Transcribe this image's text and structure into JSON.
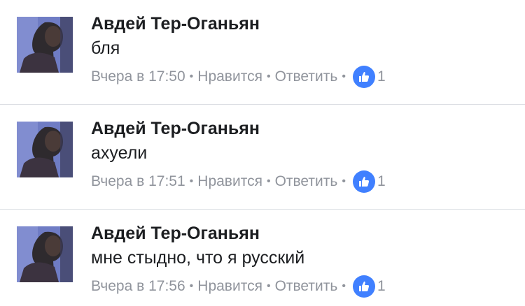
{
  "comments": [
    {
      "author": "Авдей Тер-Оганьян",
      "text": "бля",
      "time": "Вчера в 17:50",
      "like_label": "Нравится",
      "reply_label": "Ответить",
      "likes": "1"
    },
    {
      "author": "Авдей Тер-Оганьян",
      "text": "ахуели",
      "time": "Вчера в 17:51",
      "like_label": "Нравится",
      "reply_label": "Ответить",
      "likes": "1"
    },
    {
      "author": "Авдей Тер-Оганьян",
      "text": "мне стыдно, что я русский",
      "time": "Вчера в 17:56",
      "like_label": "Нравится",
      "reply_label": "Ответить",
      "likes": "1"
    }
  ],
  "colors": {
    "like_badge": "#4080ff",
    "meta_text": "#90949c",
    "divider": "#dcdfe4"
  },
  "icons": {
    "like": "thumbs-up-icon",
    "separator": "middle-dot"
  }
}
